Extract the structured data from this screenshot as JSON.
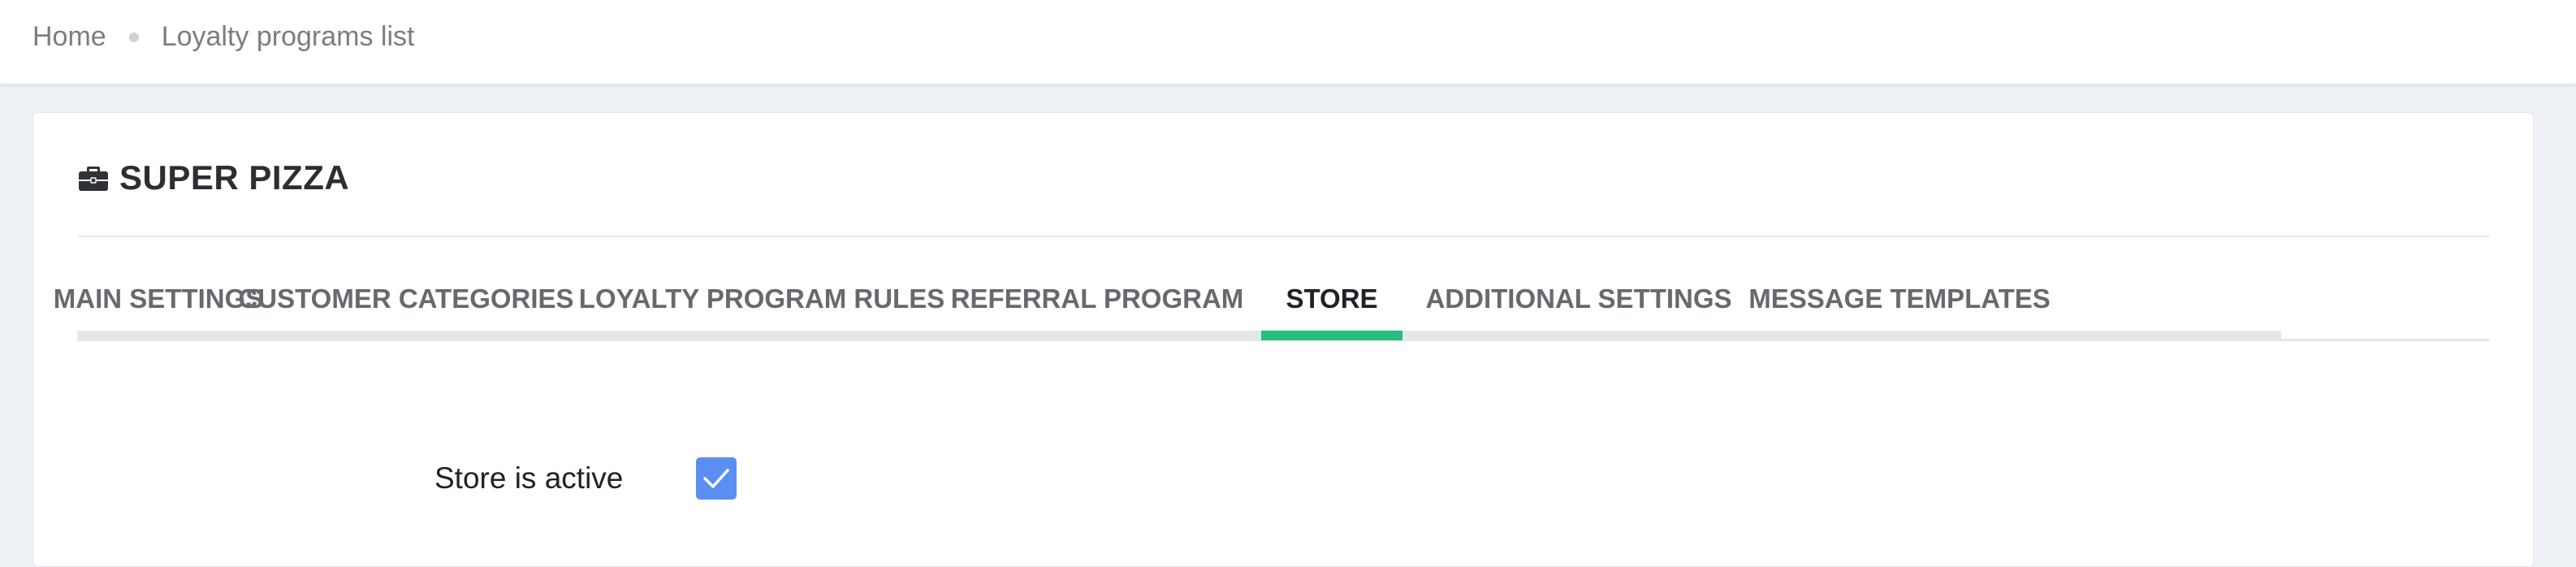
{
  "breadcrumb": {
    "items": [
      {
        "label": "Home"
      },
      {
        "label": "Loyalty programs list"
      }
    ]
  },
  "card": {
    "icon": "briefcase-icon",
    "title": "SUPER PIZZA"
  },
  "tabs": [
    {
      "label": "MAIN SETTINGS",
      "active": false
    },
    {
      "label": "CUSTOMER CATEGORIES",
      "active": false
    },
    {
      "label": "LOYALTY PROGRAM RULES",
      "active": false
    },
    {
      "label": "REFERRAL PROGRAM",
      "active": false
    },
    {
      "label": "STORE",
      "active": true
    },
    {
      "label": "ADDITIONAL SETTINGS",
      "active": false
    },
    {
      "label": "MESSAGE TEMPLATES",
      "active": false
    }
  ],
  "store": {
    "active_label": "Store is active",
    "active_checked": true
  },
  "colors": {
    "active_tab_underline": "#27bd7c",
    "checkbox": "#5b8ef0",
    "page_background": "#eef1f5"
  }
}
